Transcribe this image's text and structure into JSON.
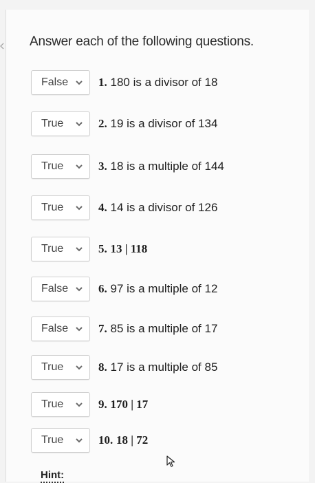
{
  "heading": "Answer each of the following questions.",
  "questions": [
    {
      "answer": "False",
      "num": "1.",
      "text": "180 is a divisor of 18"
    },
    {
      "answer": "True",
      "num": "2.",
      "text": "19 is a divisor of 134"
    },
    {
      "answer": "True",
      "num": "3.",
      "text": "18 is a multiple of 144"
    },
    {
      "answer": "True",
      "num": "4.",
      "text": "14 is a divisor of 126"
    },
    {
      "answer": "True",
      "num": "5.",
      "text": "13 | 118"
    },
    {
      "answer": "False",
      "num": "6.",
      "text": "97 is a multiple of 12"
    },
    {
      "answer": "False",
      "num": "7.",
      "text": "85 is a multiple of 17"
    },
    {
      "answer": "True",
      "num": "8.",
      "text": "17 is a multiple of 85"
    },
    {
      "answer": "True",
      "num": "9.",
      "text": "170 | 17"
    },
    {
      "answer": "True",
      "num": "10.",
      "text": "18 | 72"
    }
  ],
  "hint_label": "Hint:",
  "icons": {
    "dropdown": "chevron-down-icon",
    "cursor": "mouse-pointer-icon"
  },
  "colors": {
    "chevron": "#6b6b6b",
    "background": "#fbfbfb"
  }
}
